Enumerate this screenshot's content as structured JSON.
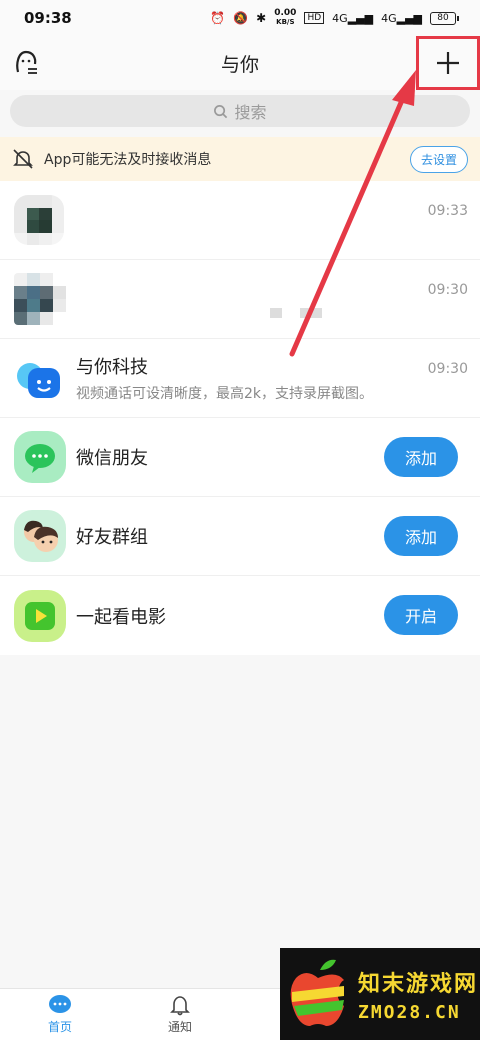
{
  "status_bar": {
    "time": "09:38",
    "speed": "0.00",
    "speed_unit": "KB/S",
    "hd": "HD",
    "net1": "4G",
    "net2": "4G",
    "battery": "80"
  },
  "header": {
    "title": "与你",
    "add_icon": "plus-icon",
    "left_icon": "contacts-icon"
  },
  "search": {
    "placeholder": "搜索"
  },
  "notice": {
    "text": "App可能无法及时接收消息",
    "button": "去设置"
  },
  "list": [
    {
      "name": "",
      "time": "09:33"
    },
    {
      "name": "",
      "time": "09:30"
    },
    {
      "name": "与你科技",
      "subtitle": "视频通话可设清晰度，最高2k，支持录屏截图。",
      "time": "09:30"
    },
    {
      "name": "微信朋友",
      "button": "添加"
    },
    {
      "name": "好友群组",
      "button": "添加"
    },
    {
      "name": "一起看电影",
      "button": "开启"
    }
  ],
  "bottom_nav": [
    {
      "label": "首页"
    },
    {
      "label": "通知"
    }
  ],
  "watermark": {
    "cn": "知末游戏网",
    "en": "ZMO28.CN"
  },
  "colors": {
    "accent": "#2b93e7",
    "highlight": "#e53946"
  }
}
